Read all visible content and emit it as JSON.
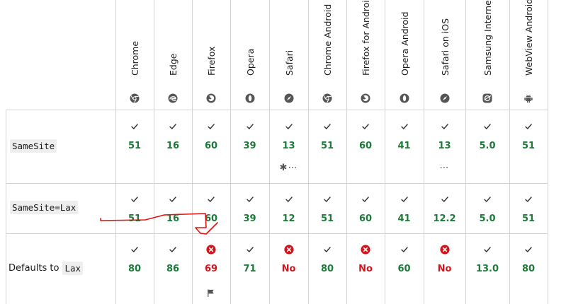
{
  "browsers": [
    {
      "name": "Chrome",
      "icon": "chrome-icon"
    },
    {
      "name": "Edge",
      "icon": "edge-icon"
    },
    {
      "name": "Firefox",
      "icon": "firefox-icon"
    },
    {
      "name": "Opera",
      "icon": "opera-icon"
    },
    {
      "name": "Safari",
      "icon": "safari-icon"
    },
    {
      "name": "Chrome Android",
      "icon": "chrome-icon"
    },
    {
      "name": "Firefox for Android",
      "icon": "firefox-icon"
    },
    {
      "name": "Opera Android",
      "icon": "opera-icon"
    },
    {
      "name": "Safari on iOS",
      "icon": "safari-icon"
    },
    {
      "name": "Samsung Internet",
      "icon": "samsung-internet-icon"
    },
    {
      "name": "WebView Android",
      "icon": "android-icon"
    }
  ],
  "features": [
    {
      "prefix": "",
      "code": "SameSite",
      "cells": [
        {
          "status": "yes",
          "version": "51"
        },
        {
          "status": "yes",
          "version": "16"
        },
        {
          "status": "yes",
          "version": "60"
        },
        {
          "status": "yes",
          "version": "39"
        },
        {
          "status": "yes",
          "version": "13",
          "note": "✱⋯"
        },
        {
          "status": "yes",
          "version": "51"
        },
        {
          "status": "yes",
          "version": "60"
        },
        {
          "status": "yes",
          "version": "41"
        },
        {
          "status": "yes",
          "version": "13",
          "note": "⋯"
        },
        {
          "status": "yes",
          "version": "5.0"
        },
        {
          "status": "yes",
          "version": "51"
        }
      ]
    },
    {
      "prefix": "",
      "code": "SameSite=Lax",
      "cells": [
        {
          "status": "yes",
          "version": "51"
        },
        {
          "status": "yes",
          "version": "16"
        },
        {
          "status": "yes",
          "version": "60"
        },
        {
          "status": "yes",
          "version": "39"
        },
        {
          "status": "yes",
          "version": "12"
        },
        {
          "status": "yes",
          "version": "51"
        },
        {
          "status": "yes",
          "version": "60"
        },
        {
          "status": "yes",
          "version": "41"
        },
        {
          "status": "yes",
          "version": "12.2"
        },
        {
          "status": "yes",
          "version": "5.0"
        },
        {
          "status": "yes",
          "version": "51"
        }
      ]
    },
    {
      "prefix": "Defaults to",
      "code": "Lax",
      "cells": [
        {
          "status": "yes",
          "version": "80"
        },
        {
          "status": "yes",
          "version": "86"
        },
        {
          "status": "no",
          "version": "69",
          "flag": true
        },
        {
          "status": "yes",
          "version": "71"
        },
        {
          "status": "no",
          "version": "No"
        },
        {
          "status": "yes",
          "version": "80"
        },
        {
          "status": "no",
          "version": "No"
        },
        {
          "status": "yes",
          "version": "60"
        },
        {
          "status": "no",
          "version": "No"
        },
        {
          "status": "yes",
          "version": "13.0"
        },
        {
          "status": "yes",
          "version": "80"
        }
      ]
    }
  ],
  "colors": {
    "supported": "#1d7a38",
    "unsupported": "#d3141d",
    "annotation": "#e01010",
    "grid": "#d3d3d3"
  }
}
